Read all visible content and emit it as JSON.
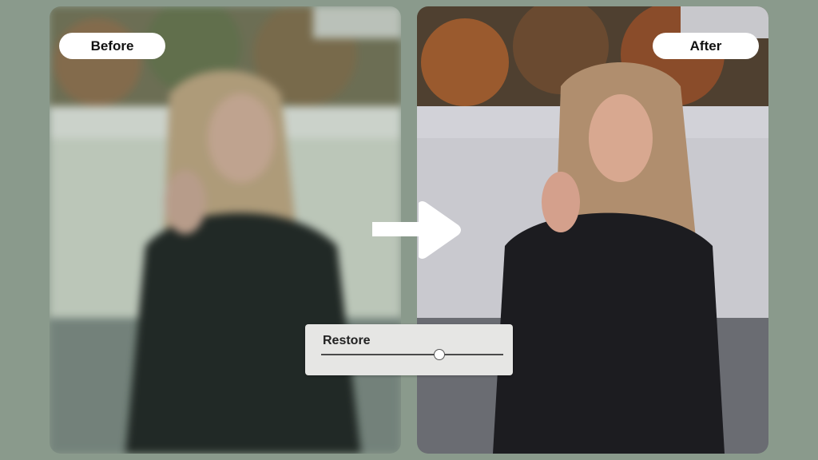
{
  "before": {
    "label": "Before"
  },
  "after": {
    "label": "After"
  },
  "restore": {
    "label": "Restore",
    "slider_value": 0.65
  },
  "colors": {
    "background": "#8a9a8c",
    "badge_bg": "#ffffff",
    "card_bg": "#e6e6e4",
    "arrow": "#ffffff"
  },
  "icons": {
    "arrow": "right-arrow-icon"
  }
}
